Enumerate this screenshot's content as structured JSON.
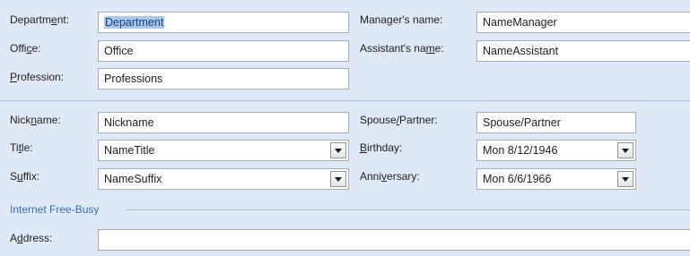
{
  "labels": {
    "department": [
      "Department: ",
      "Departm",
      "e",
      "nt:"
    ],
    "office": [
      "Offi",
      "c",
      "e:"
    ],
    "profession": [
      "",
      "P",
      "rofession:"
    ],
    "manager": [
      "Mana",
      "g",
      "er's name:"
    ],
    "assistant": [
      "Assistant's na",
      "m",
      "e:"
    ],
    "nickname": [
      "Nick",
      "n",
      "ame:"
    ],
    "title": [
      "Ti",
      "t",
      "le:"
    ],
    "suffix": [
      "S",
      "u",
      "ffix:"
    ],
    "spouse": [
      "Spouse",
      "/",
      "Partner:"
    ],
    "birthday": [
      "",
      "B",
      "irthday:"
    ],
    "anniversary": [
      "Anni",
      "v",
      "ersary:"
    ],
    "address": [
      "A",
      "d",
      "dress:"
    ]
  },
  "fields": {
    "department": "Department",
    "office": "Office",
    "profession": "Professions",
    "manager": "NameManager",
    "assistant": "NameAssistant",
    "nickname": "Nickname",
    "title": "NameTitle",
    "suffix": "NameSuffix",
    "spouse": "Spouse/Partner",
    "birthday": "Mon 8/12/1946",
    "anniversary": "Mon 6/6/1966",
    "address": ""
  },
  "section": {
    "internet_free_busy": "Internet Free-Busy"
  },
  "colors": {
    "background": "#dfe9f5",
    "section_heading": "#3a6db1",
    "selection": "#a8c8ec"
  }
}
